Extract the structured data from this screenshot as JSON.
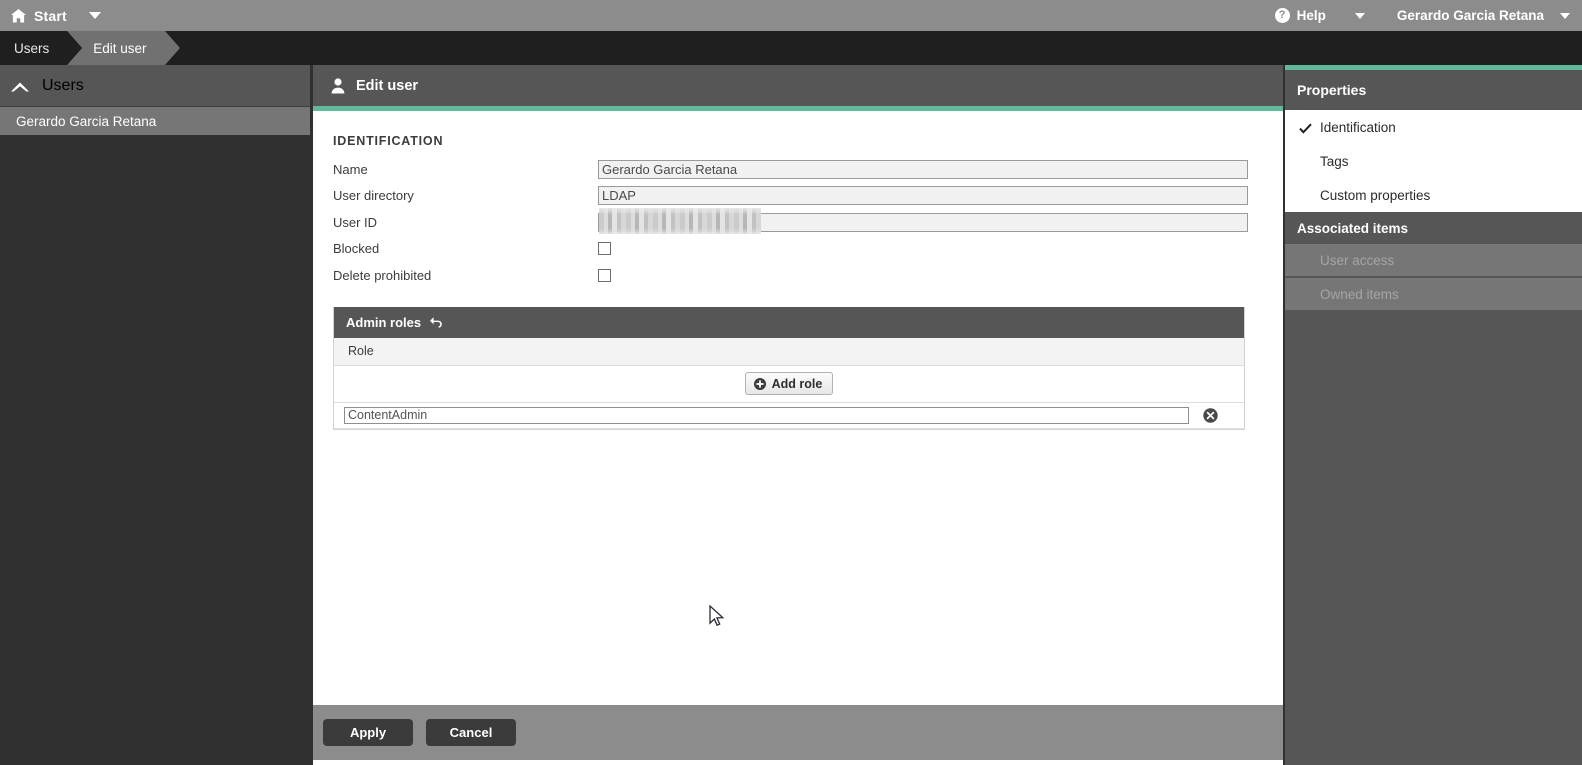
{
  "topbar": {
    "home_icon": "home-icon",
    "start_label": "Start",
    "start_caret": "chevron-down-icon",
    "help_icon": "?",
    "help_label": "Help",
    "help_caret": "chevron-down-icon",
    "user_label": "Gerardo Garcia Retana",
    "user_caret": "chevron-down-icon"
  },
  "breadcrumb": {
    "items": [
      {
        "label": "Users",
        "active": false
      },
      {
        "label": "Edit user",
        "active": true
      }
    ]
  },
  "sidebar": {
    "header": {
      "label": "Users",
      "icon": "chevron-up-icon"
    },
    "items": [
      {
        "label": "Gerardo Garcia Retana",
        "selected": true
      }
    ]
  },
  "content": {
    "icon": "user-icon",
    "title": "Edit user",
    "accent_color": "#62b99a",
    "section_title": "IDENTIFICATION",
    "fields": [
      {
        "label": "Name",
        "type": "text",
        "value": "Gerardo Garcia Retana"
      },
      {
        "label": "User directory",
        "type": "text",
        "value": "LDAP"
      },
      {
        "label": "User ID",
        "type": "text-redacted",
        "value": ""
      },
      {
        "label": "Blocked",
        "type": "checkbox",
        "checked": false
      },
      {
        "label": "Delete prohibited",
        "type": "checkbox",
        "checked": false
      }
    ],
    "admin_roles": {
      "title": "Admin roles",
      "reset_icon": "undo-arrow-icon",
      "column_header": "Role",
      "add_button": {
        "label": "Add role",
        "icon": "plus-circle-icon"
      },
      "rows": [
        {
          "value": "ContentAdmin",
          "delete_icon": "delete-circle-icon"
        }
      ]
    }
  },
  "actionbar": {
    "apply_label": "Apply",
    "cancel_label": "Cancel"
  },
  "rightpanel": {
    "properties_title": "Properties",
    "properties_items": [
      {
        "label": "Identification",
        "checked": true
      },
      {
        "label": "Tags",
        "checked": false
      },
      {
        "label": "Custom properties",
        "checked": false
      }
    ],
    "associated_title": "Associated items",
    "associated_items": [
      {
        "label": "User access",
        "disabled": true
      },
      {
        "label": "Owned items",
        "disabled": true
      }
    ]
  }
}
